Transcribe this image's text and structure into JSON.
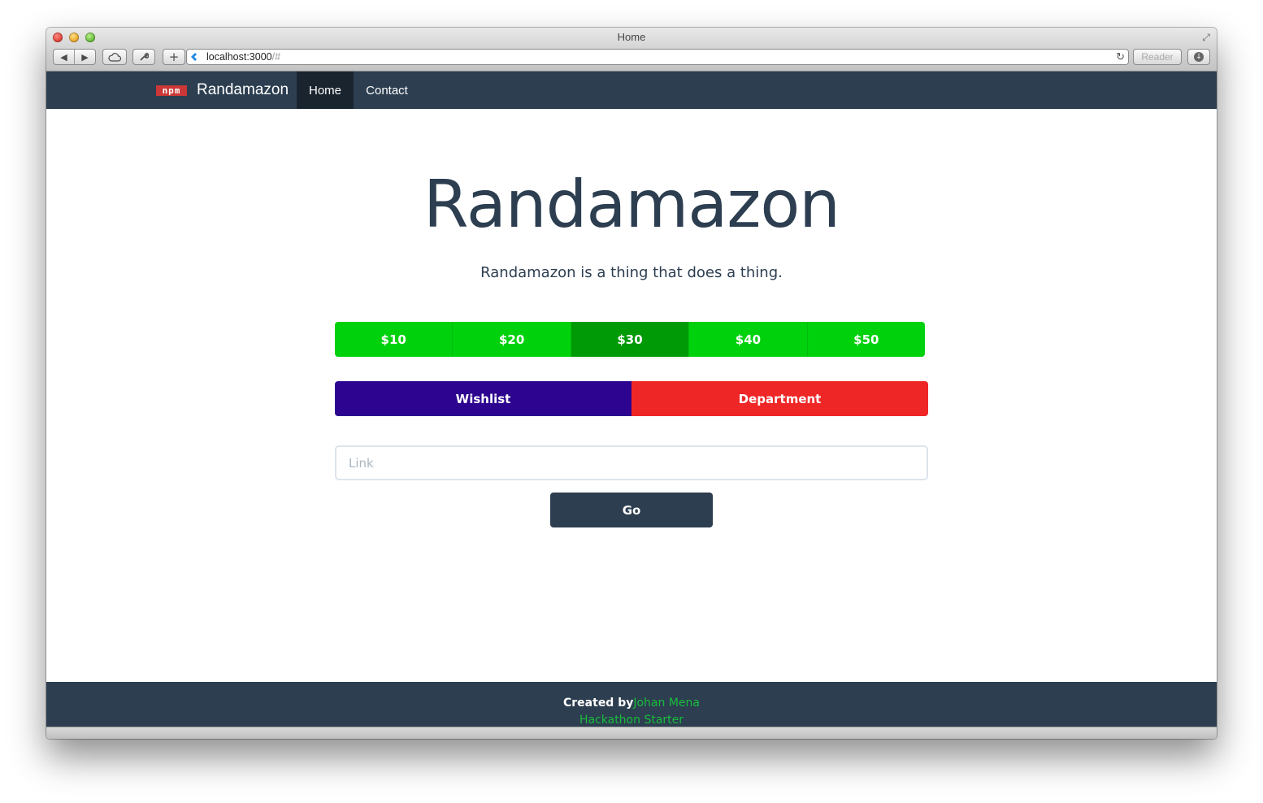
{
  "browser": {
    "window_title": "Home",
    "url_host": "localhost:3000",
    "url_hash": "/#",
    "reader_label": "Reader"
  },
  "navbar": {
    "logo_text": "npm",
    "brand": "Randamazon",
    "items": [
      {
        "label": "Home",
        "active": true
      },
      {
        "label": "Contact",
        "active": false
      }
    ]
  },
  "hero": {
    "title": "Randamazon",
    "subtitle": "Randamazon is a thing that does a thing."
  },
  "price_options": [
    {
      "label": "$10",
      "active": false
    },
    {
      "label": "$20",
      "active": false
    },
    {
      "label": "$30",
      "active": true
    },
    {
      "label": "$40",
      "active": false
    },
    {
      "label": "$50",
      "active": false
    }
  ],
  "categories": {
    "wishlist_label": "Wishlist",
    "department_label": "Department"
  },
  "link_input": {
    "value": "",
    "placeholder": "Link"
  },
  "go_button": {
    "label": "Go"
  },
  "footer": {
    "created_by": "Created by",
    "author": "Johan Mena",
    "project": "Hackathon Starter"
  },
  "colors": {
    "navbar": "#2c3e50",
    "price_green": "#00d10d",
    "price_active": "#009a07",
    "wishlist": "#2c0490",
    "department": "#ef2626",
    "footer_link": "#1abc3c"
  }
}
